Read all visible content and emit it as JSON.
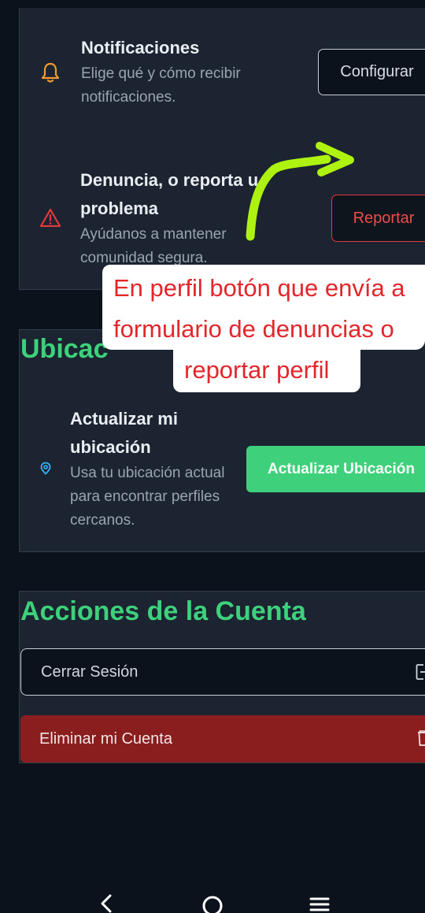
{
  "preferences": {
    "notifications": {
      "title": "Notificaciones",
      "description_line1": "Elige qué y cómo recibir",
      "description_line2": "notificaciones.",
      "button": "Configurar"
    },
    "report": {
      "title_line1": "Denuncia, o reporta u",
      "title_line2": "problema",
      "description_line1": "Ayúdanos a mantener",
      "description_line2": "comunidad segura.",
      "button": "Reportar"
    }
  },
  "location": {
    "heading": "Ubicac",
    "title_line1": "Actualizar mi",
    "title_line2": "ubicación",
    "description_line1": "Usa tu ubicación actual",
    "description_line2": "para encontrar perfiles",
    "description_line3": "cercanos.",
    "button": "Actualizar Ubicación"
  },
  "account": {
    "heading": "Acciones de la Cuenta",
    "logout_label": "Cerrar Sesión",
    "delete_label": "Eliminar mi Cuenta"
  },
  "annotation": {
    "line1": "En perfil botón que envía a",
    "line2": "formulario de denuncias o",
    "line3": "reportar perfil",
    "arrow_color": "#aef212",
    "text_color": "#e3262b"
  },
  "colors": {
    "accent_green": "#3dd17c",
    "danger_red": "#e03a3a",
    "bell_orange": "#f29a2e",
    "pin_cyan": "#33b4f0"
  },
  "icons": [
    "bell-icon",
    "warning-icon",
    "location-pin-icon",
    "logout-icon",
    "trash-icon",
    "back-icon",
    "home-icon",
    "menu-icon"
  ]
}
